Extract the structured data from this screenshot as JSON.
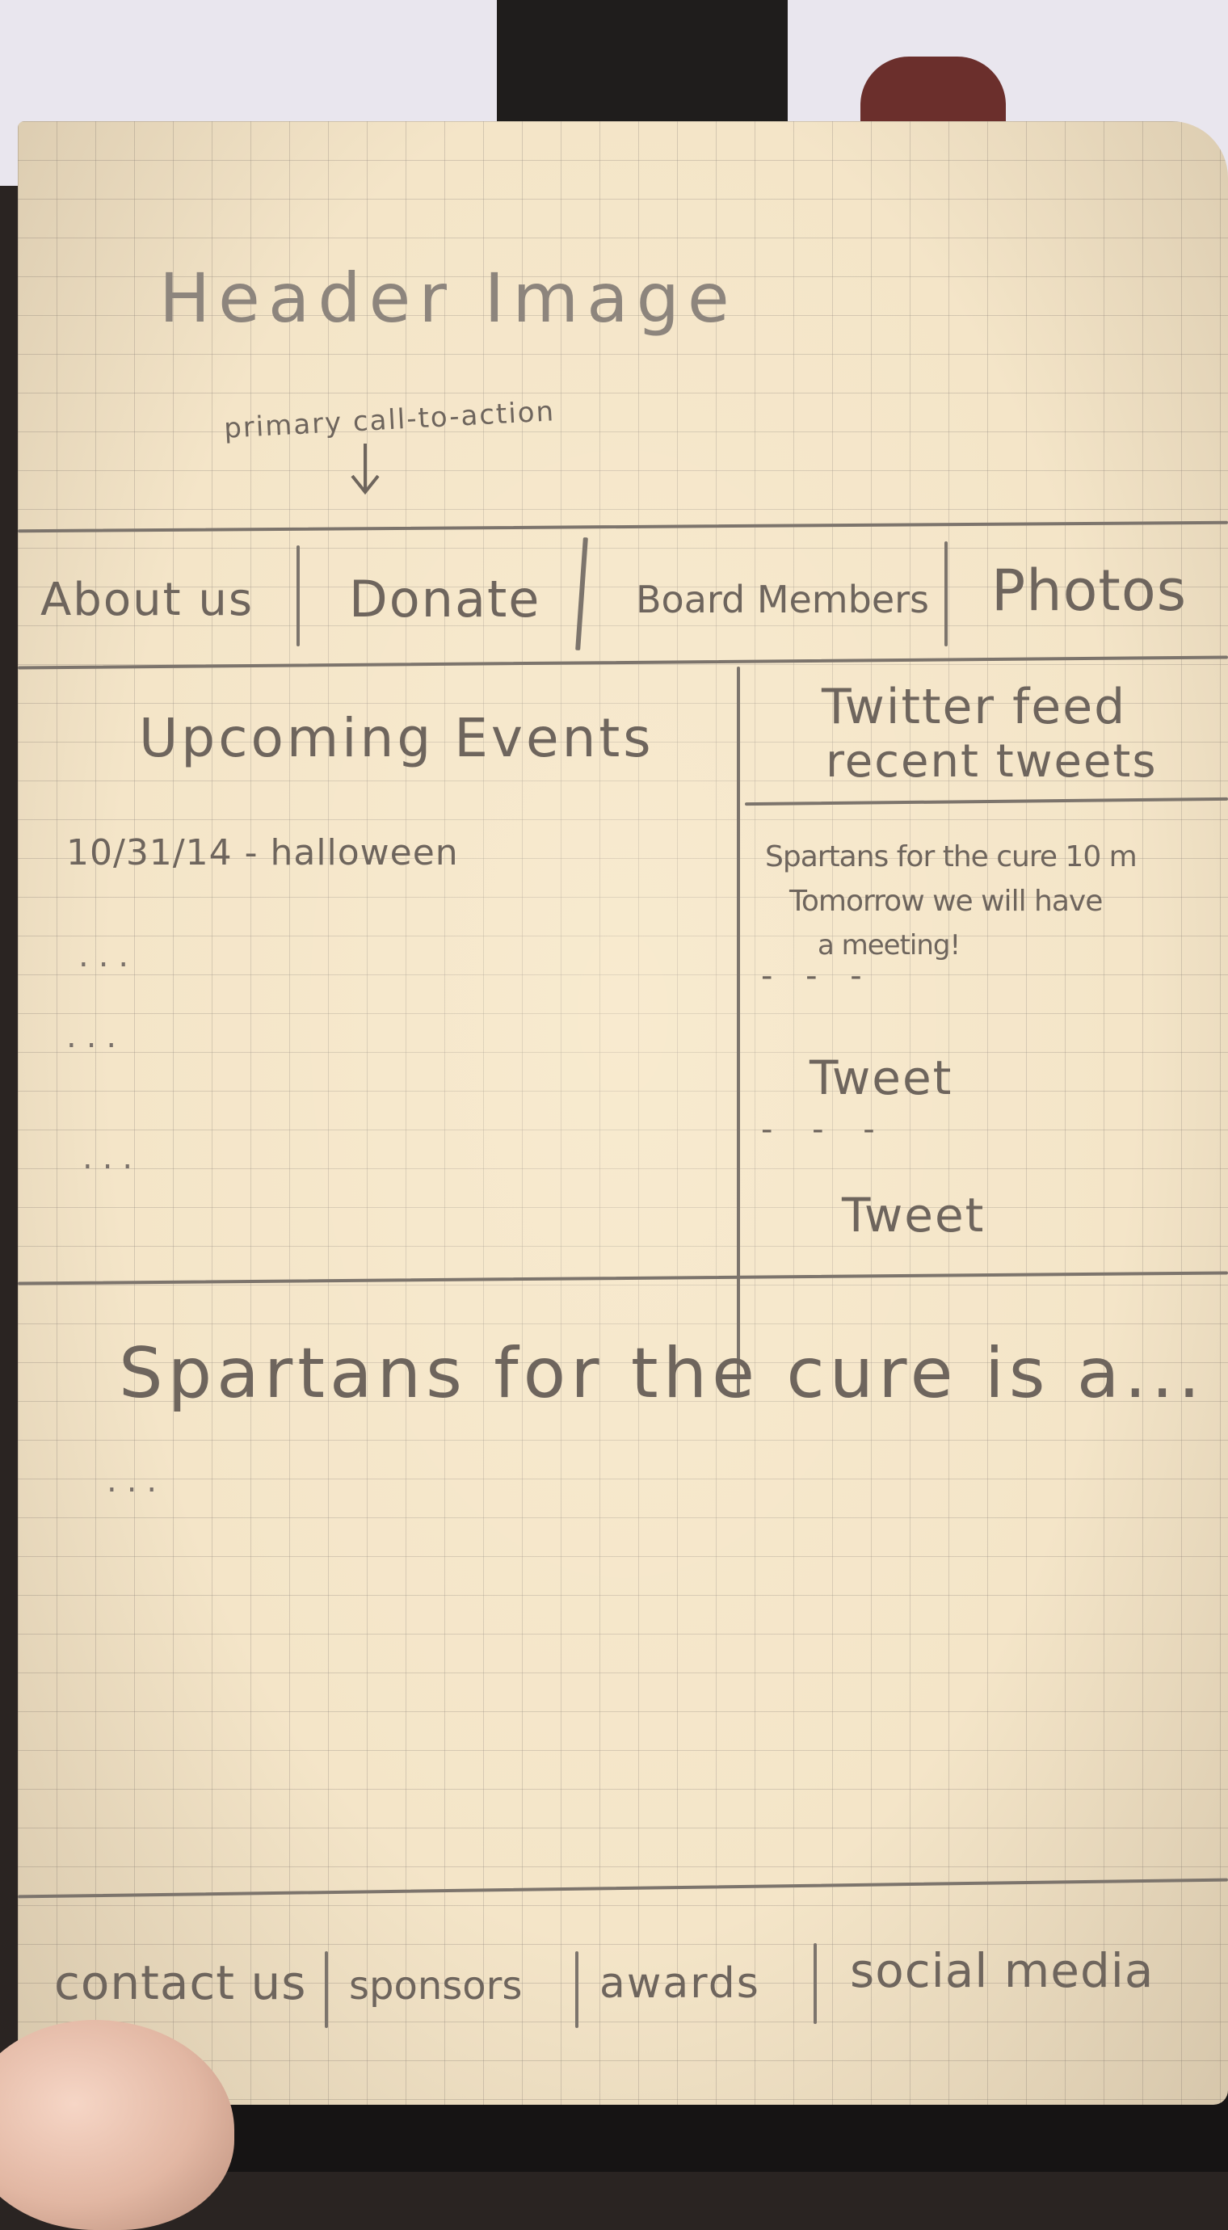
{
  "header": {
    "image_label": "Header Image",
    "cta_note": "primary call-to-action"
  },
  "nav": {
    "items": [
      "About us",
      "Donate",
      "Board Members",
      "Photos"
    ]
  },
  "events": {
    "title": "Upcoming Events",
    "first_event": "10/31/14 - halloween",
    "placeholders": [
      "...",
      "...",
      "..."
    ]
  },
  "twitter": {
    "title_line1": "Twitter feed",
    "title_line2": "recent tweets",
    "tweet_1_line1": "Spartans for the cure 10 m",
    "tweet_1_line2": "Tomorrow we will have",
    "tweet_1_line3": "a meeting!",
    "tweets": [
      "Tweet",
      "Tweet"
    ]
  },
  "about": {
    "text": "Spartans for the cure is a...",
    "continuation": "..."
  },
  "footer": {
    "items": [
      "contact us",
      "sponsors",
      "awards",
      "social media"
    ]
  }
}
